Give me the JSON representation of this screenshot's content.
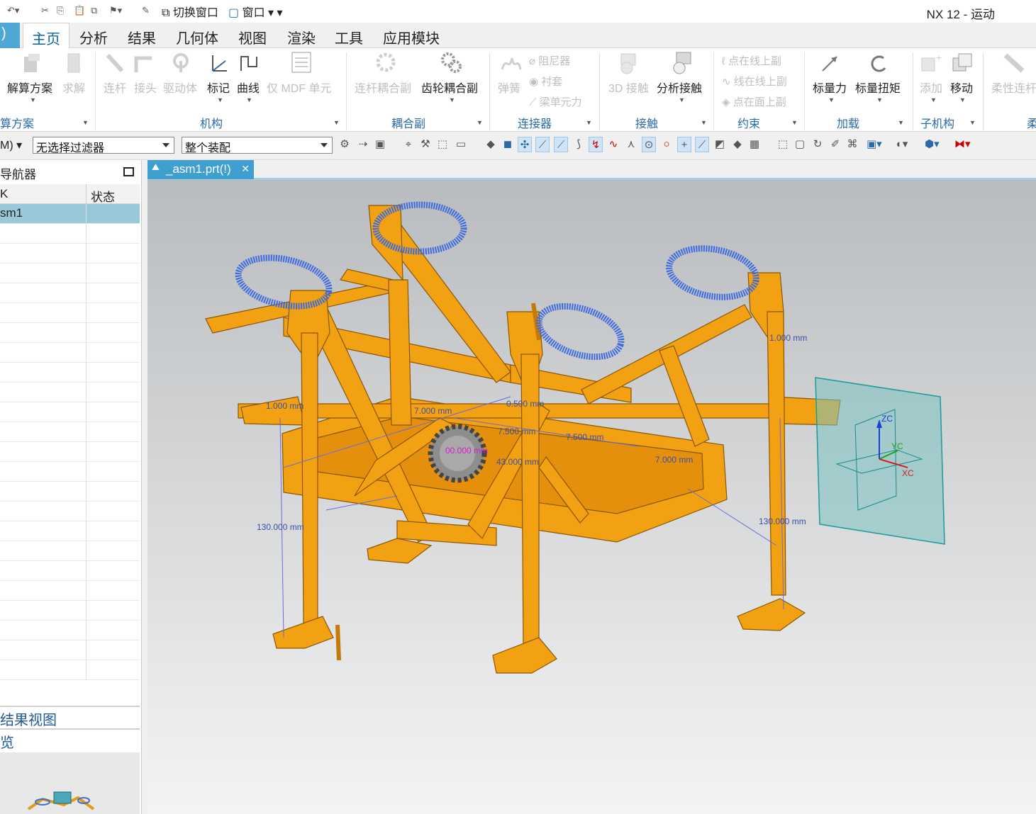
{
  "app": {
    "title": "NX 12 - 运动"
  },
  "quick_access": {
    "switch_window": "切换窗口",
    "window": "窗口"
  },
  "menu": [
    "主页",
    "分析",
    "结果",
    "几何体",
    "视图",
    "渲染",
    "工具",
    "应用模块"
  ],
  "ribbon": {
    "solution_group": {
      "label": "算方案",
      "solve_solution": "解算方案",
      "solve": "求解"
    },
    "mechanism_group": {
      "label": "机构",
      "link": "连杆",
      "joint": "接头",
      "driver": "驱动体",
      "marker": "标记",
      "curve": "曲线",
      "mdf": "仅 MDF 单元"
    },
    "coupler_group": {
      "label": "耦合副",
      "link_coupler": "连杆耦合副",
      "gear_coupler": "齿轮耦合副"
    },
    "connector_group": {
      "label": "连接器",
      "spring": "弹簧",
      "damper": "阻尼器",
      "bushing": "衬套",
      "beam": "梁单元力"
    },
    "contact_group": {
      "label": "接触",
      "contact3d": "3D 接触",
      "analysis_contact": "分析接触"
    },
    "constraint_group": {
      "label": "约束",
      "point_on_curve": "点在线上副",
      "curve_on_curve": "线在线上副",
      "point_on_surface": "点在面上副"
    },
    "load_group": {
      "label": "加载",
      "scalar_force": "标量力",
      "scalar_torque": "标量扭矩"
    },
    "submech_group": {
      "label": "子机构",
      "add": "添加",
      "move": "移动"
    },
    "flex_group": {
      "label": "柔",
      "flex_link": "柔性连杆"
    }
  },
  "toolbar2": {
    "filter_left": "M)",
    "selection_filter": "无选择过滤器",
    "scope": "整个装配"
  },
  "navigator": {
    "title": "导航器",
    "col_name": "K",
    "col_status": "状态",
    "selected_row": "sm1",
    "results_view": "结果视图",
    "preview": "览"
  },
  "tab": {
    "label": "_asm1.prt(!)"
  },
  "annotations": {
    "dim1": "1.000 mm",
    "dim2": "7.000 mm",
    "dim3": "0.500 mm",
    "dim4": "7.500 mm",
    "dim5": "7.500 mm",
    "dim6": "7.000 mm",
    "dim7": "130.000 mm",
    "dim8": "130.000 mm",
    "dim9": "1.000 mm",
    "dim10": "00.000 mm",
    "dim11": "43.000 mm",
    "axis_zc": "ZC",
    "axis_yc": "YC",
    "axis_xc": "XC"
  }
}
